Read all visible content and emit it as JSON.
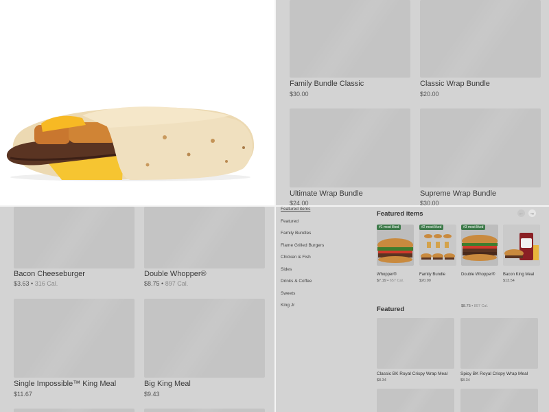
{
  "hero": {
    "image_icon": "breakfast-wrap-image"
  },
  "bundles": [
    {
      "name": "Family Bundle Classic",
      "price": "$30.00"
    },
    {
      "name": "Classic Wrap Bundle",
      "price": "$20.00"
    },
    {
      "name": "Ultimate Wrap Bundle",
      "price": "$24.00"
    },
    {
      "name": "Supreme Wrap Bundle",
      "price": "$30.00"
    }
  ],
  "menu_items": [
    {
      "name": "Bacon Cheeseburger",
      "price": "$3.63",
      "cal": "316 Cal."
    },
    {
      "name": "Double Whopper®",
      "price": "$8.75",
      "cal": "897 Cal."
    },
    {
      "name": "Single Impossible™ King Meal",
      "price": "$11.67",
      "cal": ""
    },
    {
      "name": "Big King Meal",
      "price": "$9.43",
      "cal": ""
    }
  ],
  "sidebar": {
    "items": [
      {
        "label": "Featured items"
      },
      {
        "label": "Featured"
      },
      {
        "label": "Family Bundles"
      },
      {
        "label": "Flame Grilled Burgers"
      },
      {
        "label": "Chicken & Fish"
      },
      {
        "label": "Sides"
      },
      {
        "label": "Drinks & Coffee"
      },
      {
        "label": "Sweets"
      },
      {
        "label": "King Jr"
      }
    ]
  },
  "featured_items": {
    "title": "Featured items",
    "prev_icon": "arrow-left-icon",
    "next_icon": "arrow-right-icon",
    "cards": [
      {
        "badge": "#1 most liked",
        "name": "Whopper®",
        "price": "$7.19",
        "cal": "657 Cal."
      },
      {
        "badge": "#2 most liked",
        "name": "Family Bundle",
        "price": "$20.00",
        "cal": ""
      },
      {
        "badge": "#3 most liked",
        "name": "Double Whopper®",
        "price": "$8.75",
        "cal": "897 Cal."
      },
      {
        "badge": "",
        "name": "Bacon King Meal",
        "price": "$13.54",
        "cal": ""
      }
    ]
  },
  "featured": {
    "title": "Featured",
    "items": [
      {
        "name": "Classic BK Royal Crispy Wrap Meal",
        "price": "$8.34"
      },
      {
        "name": "Spicy BK Royal Crispy Wrap  Meal",
        "price": "$8.34"
      }
    ]
  },
  "colors": {
    "badge": "#3d7a4a",
    "placeholder": "#c4c4c4",
    "divider": "#f4f4f4"
  }
}
